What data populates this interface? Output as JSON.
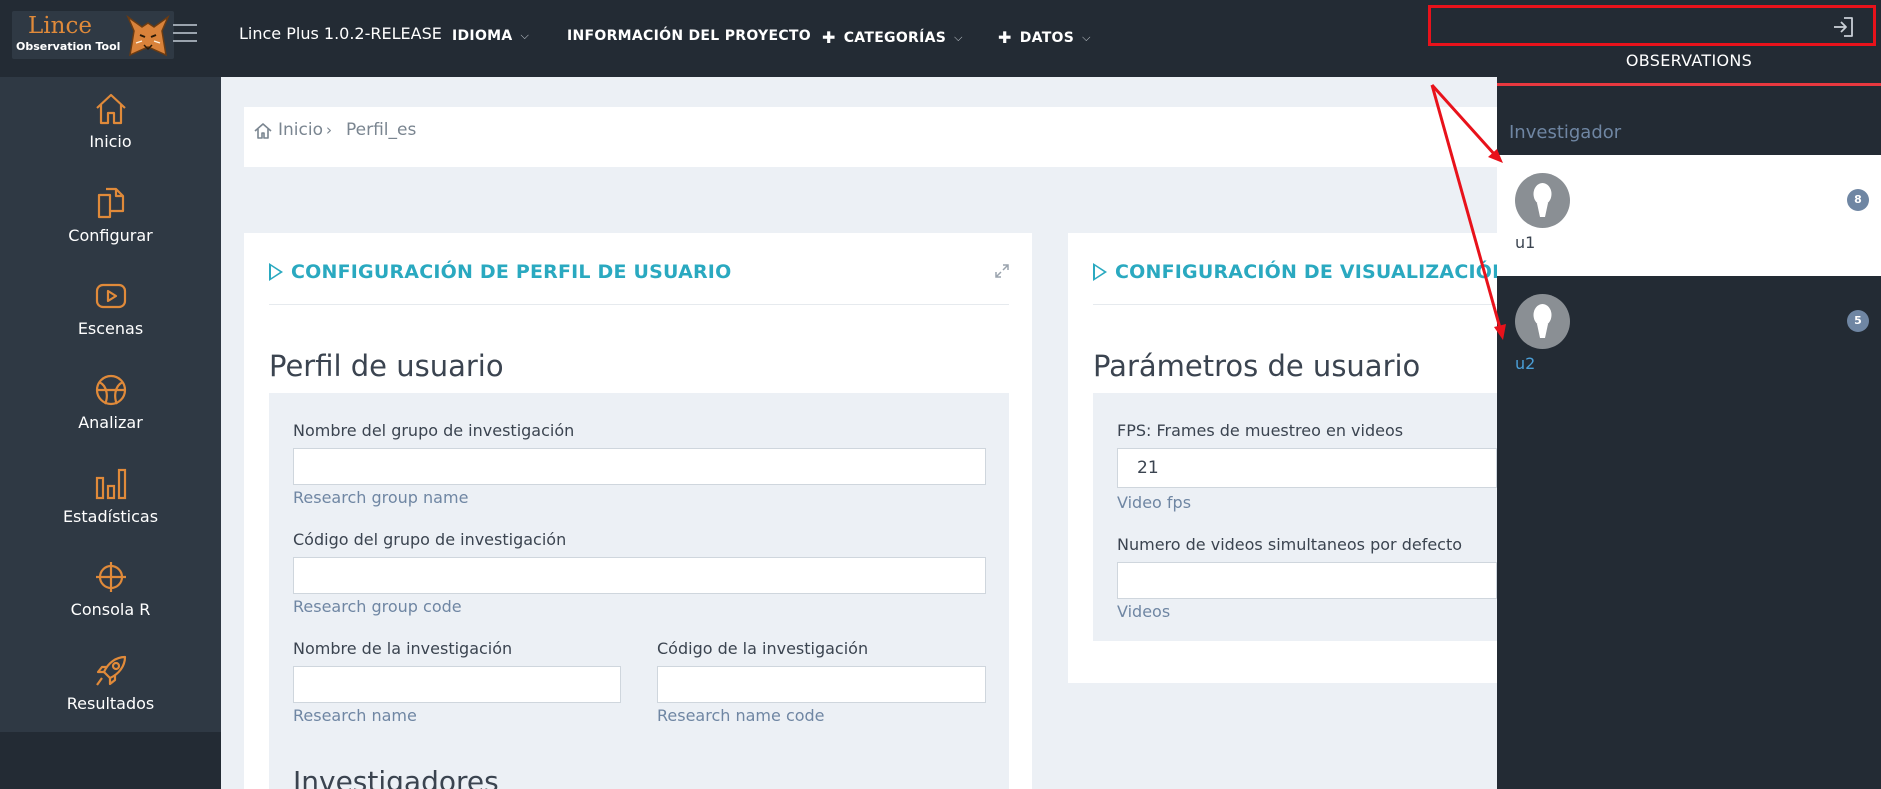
{
  "topbar": {
    "logo_title": "Lince",
    "logo_subtitle": "Observation Tool",
    "app_version": "Lince Plus 1.0.2-RELEASE",
    "nav": [
      {
        "label": "IDIOMA",
        "has_plus": false
      },
      {
        "label": "INFORMACIÓN DEL PROYECTO",
        "has_plus": false
      },
      {
        "label": "CATEGORÍAS",
        "has_plus": true
      },
      {
        "label": "DATOS",
        "has_plus": true
      }
    ]
  },
  "sidebar": {
    "items": [
      {
        "label": "Inicio",
        "icon": "home-icon"
      },
      {
        "label": "Configurar",
        "icon": "documents-icon"
      },
      {
        "label": "Escenas",
        "icon": "play-icon"
      },
      {
        "label": "Analizar",
        "icon": "basketball-icon"
      },
      {
        "label": "Estadísticas",
        "icon": "bar-chart-icon"
      },
      {
        "label": "Consola R",
        "icon": "crosshair-icon"
      },
      {
        "label": "Resultados",
        "icon": "rocket-icon"
      }
    ],
    "accent_color": "#e08a3a"
  },
  "breadcrumb": {
    "home": "Inicio",
    "separator": "›",
    "current": "Perfil_es"
  },
  "profile_panel": {
    "title": "CONFIGURACIÓN DE PERFIL DE USUARIO",
    "section_title": "Perfil de usuario",
    "fields": [
      {
        "label": "Nombre del grupo de investigación",
        "value": "",
        "help": "Research group name"
      },
      {
        "label": "Código del grupo de investigación",
        "value": "",
        "help": "Research group code"
      },
      {
        "label": "Nombre de la investigación",
        "value": "",
        "help": "Research name"
      },
      {
        "label": "Código de la investigación",
        "value": "",
        "help": "Research name code"
      }
    ],
    "next_section": "Investigadores"
  },
  "display_panel": {
    "title": "CONFIGURACIÓN DE VISUALIZACIÓN",
    "section_title": "Parámetros de usuario",
    "fields": [
      {
        "label": "FPS: Frames de muestreo en videos",
        "value": "21",
        "help": "Video fps"
      },
      {
        "label": "Numero de videos simultaneos por defecto",
        "value": "",
        "help": "Videos"
      }
    ]
  },
  "observations": {
    "title": "OBSERVATIONS",
    "search_value": "",
    "group_label": "Investigador",
    "users": [
      {
        "name": "u1",
        "count": "8",
        "active": true
      },
      {
        "name": "u2",
        "count": "5",
        "active": false
      }
    ]
  },
  "colors": {
    "title_accent": "#2aa9c0",
    "highlight_red": "#e8121b",
    "help_text": "#6f86a3",
    "dark_bg": "#232b34"
  }
}
